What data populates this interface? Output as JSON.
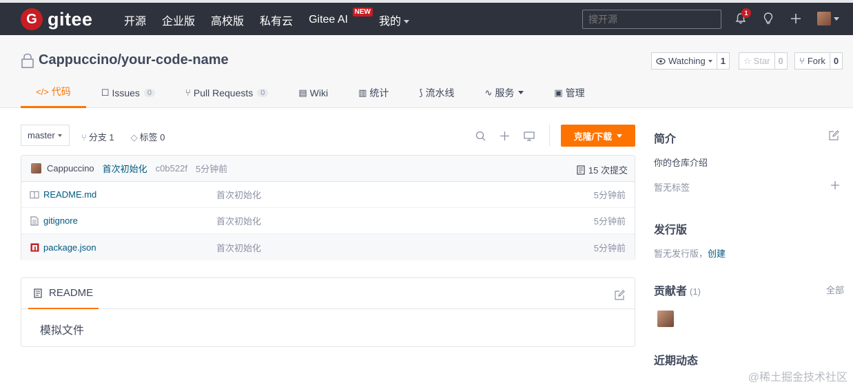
{
  "topbar": {
    "logo_letter": "G",
    "logo_text": "gitee",
    "nav": [
      "开源",
      "企业版",
      "高校版",
      "私有云",
      "Gitee AI",
      "我的"
    ],
    "new_badge": "NEW",
    "search_placeholder": "搜开源",
    "notification_count": "1"
  },
  "repo": {
    "title": "Cappuccino/your-code-name",
    "watching_label": "Watching",
    "watching_count": "1",
    "star_label": "Star",
    "star_count": "0",
    "fork_label": "Fork",
    "fork_count": "0"
  },
  "tabs": [
    {
      "icon": "</>",
      "label": "代码"
    },
    {
      "icon": "☐",
      "label": "Issues",
      "count": "0"
    },
    {
      "icon": "⑂",
      "label": "Pull Requests",
      "count": "0"
    },
    {
      "icon": "▤",
      "label": "Wiki"
    },
    {
      "icon": "▥",
      "label": "统计"
    },
    {
      "icon": "⟆",
      "label": "流水线"
    },
    {
      "icon": "∿",
      "label": "服务"
    },
    {
      "icon": "▣",
      "label": "管理"
    }
  ],
  "toolbar": {
    "branch": "master",
    "branches": "分支 1",
    "tags": "标签 0",
    "clone_label": "克隆/下载"
  },
  "commit": {
    "author": "Cappuccino",
    "message": "首次初始化",
    "hash": "c0b522f",
    "time": "5分钟前",
    "count": "15 次提交"
  },
  "files": [
    {
      "name": "README.md",
      "message": "首次初始化",
      "time": "5分钟前"
    },
    {
      "name": "gitignore",
      "message": "首次初始化",
      "time": "5分钟前"
    },
    {
      "name": "package.json",
      "message": "首次初始化",
      "time": "5分钟前"
    }
  ],
  "readme": {
    "tab_label": "README",
    "content": "模拟文件"
  },
  "sidebar": {
    "intro_title": "简介",
    "intro_text": "你的仓库介绍",
    "no_tags": "暂无标签",
    "release_title": "发行版",
    "no_release": "暂无发行版，",
    "create_link": "创建",
    "contributors_title": "贡献者",
    "contributors_count": "(1)",
    "all_link": "全部",
    "activity_title": "近期动态"
  },
  "watermark": "@稀土掘金技术社区",
  "colors": {
    "accent": "#fe7300",
    "topbar": "#2e323c",
    "brand_red": "#c71d23",
    "link": "#005980"
  }
}
